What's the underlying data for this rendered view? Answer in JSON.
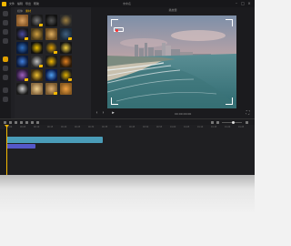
{
  "app": {
    "title": "未命名",
    "menu": [
      "文件",
      "编辑",
      "导出",
      "帮助"
    ]
  },
  "media_panel": {
    "tabs": [
      "媒体",
      "素材"
    ],
    "active_tab": 1,
    "thumbnails": [
      {
        "name": "effect-1",
        "color": "#8a5a2a",
        "accent": "#d8a060"
      },
      {
        "name": "effect-2",
        "color": "#1a1a1a",
        "accent": "#777777"
      },
      {
        "name": "effect-3",
        "color": "#111111",
        "accent": "#555555"
      },
      {
        "name": "effect-4",
        "color": "#2a2a2a",
        "accent": "#a08040"
      },
      {
        "name": "effect-5",
        "color": "#16161a",
        "accent": "#4a4aa0"
      },
      {
        "name": "effect-6",
        "color": "#4a3a1a",
        "accent": "#d0a040"
      },
      {
        "name": "effect-7",
        "color": "#6a4a20",
        "accent": "#e0b060"
      },
      {
        "name": "effect-8",
        "color": "#1a2a3a",
        "accent": "#406080"
      },
      {
        "name": "effect-9",
        "color": "#0a1a3a",
        "accent": "#3070c0"
      },
      {
        "name": "effect-10",
        "color": "#111111",
        "accent": "#f0c000"
      },
      {
        "name": "effect-11",
        "color": "#222222",
        "accent": "#e0a000"
      },
      {
        "name": "effect-12",
        "color": "#151515",
        "accent": "#f5d040"
      },
      {
        "name": "effect-13",
        "color": "#0d1a3a",
        "accent": "#4080e0"
      },
      {
        "name": "effect-14",
        "color": "#2a2a2a",
        "accent": "#c0c0c0"
      },
      {
        "name": "effect-15",
        "color": "#1a1a1a",
        "accent": "#f5b800"
      },
      {
        "name": "effect-16",
        "color": "#2a1a0a",
        "accent": "#e08020"
      },
      {
        "name": "effect-17",
        "color": "#2a1a3a",
        "accent": "#a060c0"
      },
      {
        "name": "effect-18",
        "color": "#3a2a10",
        "accent": "#f0c030"
      },
      {
        "name": "effect-19",
        "color": "#0a1a4a",
        "accent": "#50a0f0"
      },
      {
        "name": "effect-20",
        "color": "#1a1a1a",
        "accent": "#e0b000"
      },
      {
        "name": "effect-21",
        "color": "#1a1a1a",
        "accent": "#d0d0d0"
      },
      {
        "name": "effect-22",
        "color": "#8a6a40",
        "accent": "#f0d090"
      },
      {
        "name": "effect-23",
        "color": "#7a5a30",
        "accent": "#e0b070"
      },
      {
        "name": "effect-24",
        "color": "#8a5a20",
        "accent": "#f0a040"
      }
    ]
  },
  "preview": {
    "title": "播放器",
    "timecode": "00:00:00:00",
    "record_indicator": "REC"
  },
  "timeline": {
    "ruler_ticks": [
      "00:00",
      "00:05",
      "00:10",
      "00:15",
      "00:20",
      "00:25",
      "00:30",
      "00:35",
      "00:40",
      "00:45",
      "00:50",
      "00:55",
      "01:00",
      "01:05",
      "01:10",
      "01:15",
      "01:20",
      "01:25"
    ]
  },
  "colors": {
    "accent": "#f5b800",
    "video_clip": "#4a9cb8",
    "audio_clip": "#5558c8"
  }
}
